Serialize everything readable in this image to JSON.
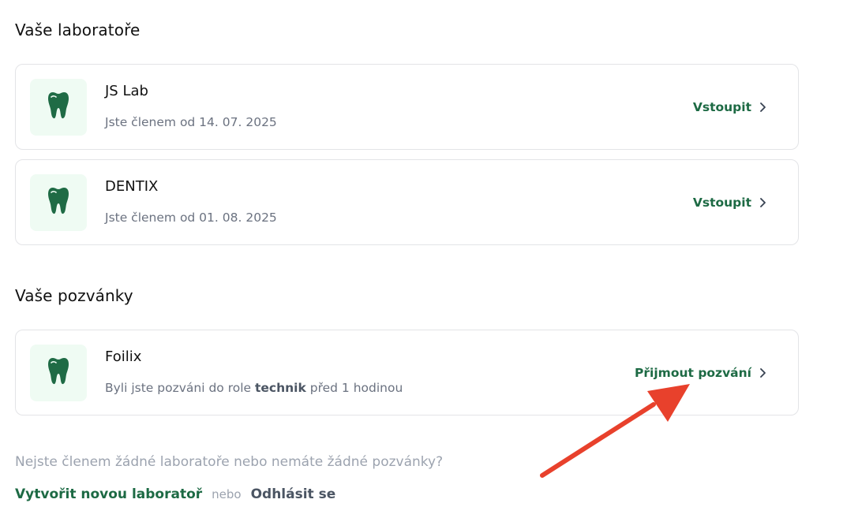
{
  "labs_section": {
    "title": "Vaše laboratoře",
    "items": [
      {
        "name": "JS Lab",
        "meta": "Jste členem od 14. 07. 2025",
        "action": "Vstoupit"
      },
      {
        "name": "DENTIX",
        "meta": "Jste členem od 01. 08. 2025",
        "action": "Vstoupit"
      }
    ]
  },
  "invites_section": {
    "title": "Vaše pozvánky",
    "items": [
      {
        "name": "Foilix",
        "meta_prefix": "Byli jste pozváni do role",
        "role": "technik",
        "meta_suffix": "před 1 hodinou",
        "action": "Přijmout pozvání"
      }
    ]
  },
  "footer": {
    "question": "Nejste členem žádné laboratoře nebo nemáte žádné pozvánky?",
    "create_link": "Vytvořit novou laboratoř",
    "separator": "nebo",
    "logout_link": "Odhlásit se"
  },
  "colors": {
    "accent": "#1d6a44",
    "logo_bg": "#effbf3",
    "annotation_arrow": "#e8412c"
  },
  "icons": {
    "lab_logo": "tooth-icon",
    "action_chevron": "chevron-right-icon"
  }
}
